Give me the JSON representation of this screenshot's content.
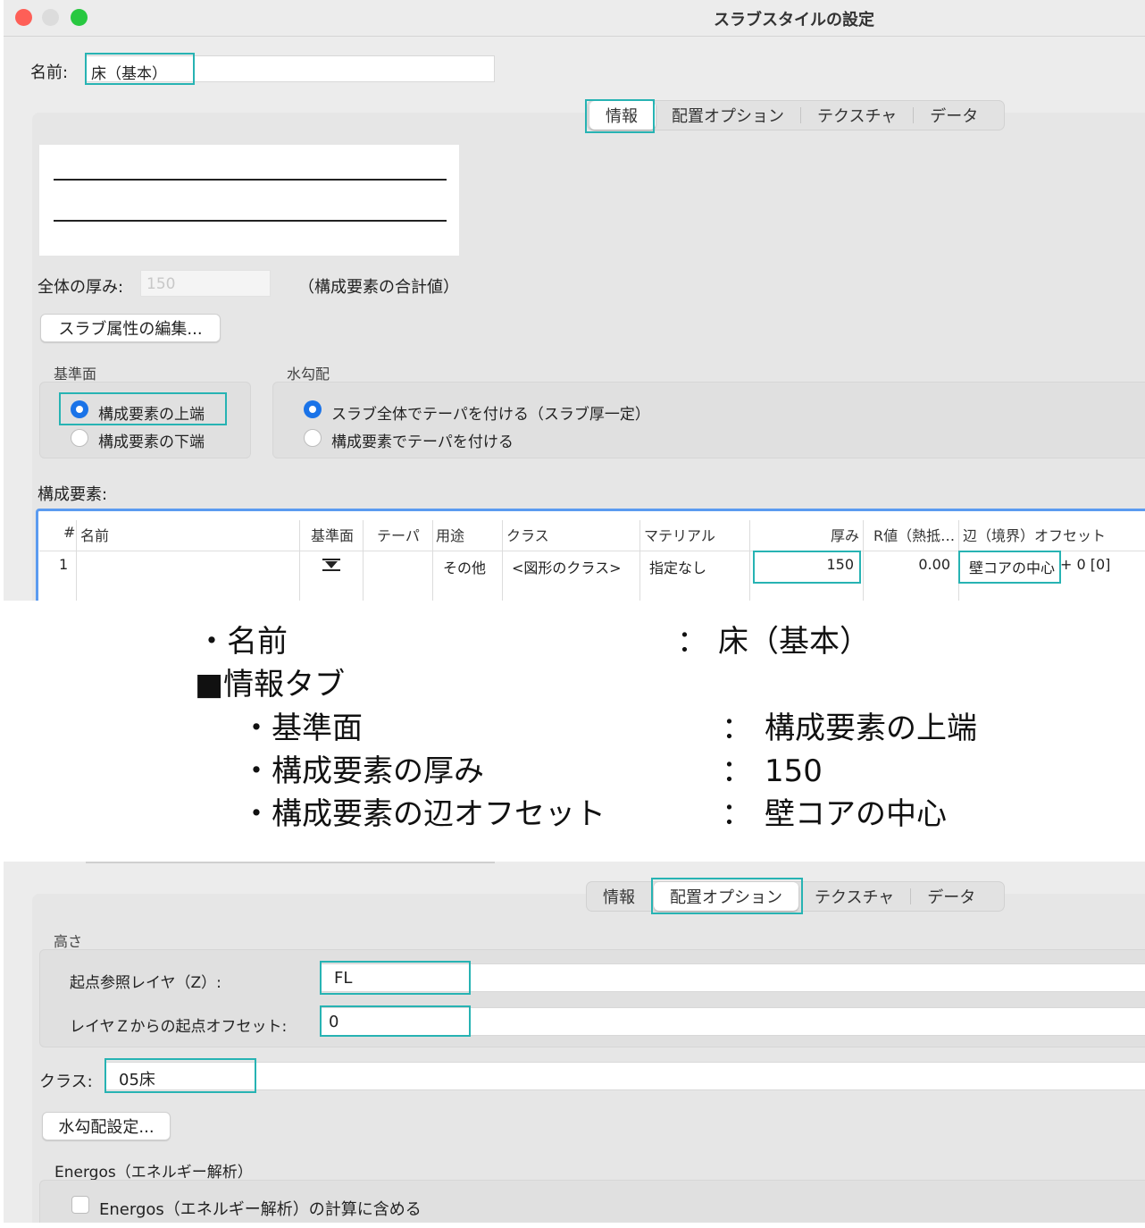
{
  "window": {
    "title": "スラブスタイルの設定",
    "name_label": "名前:",
    "name_value": "床（基本）"
  },
  "tabs": [
    "情報",
    "配置オプション",
    "テクスチャ",
    "データ"
  ],
  "info_tab": {
    "total_thickness_label": "全体の厚み:",
    "total_thickness_value": "150",
    "total_thickness_note": "（構成要素の合計値）",
    "edit_button": "スラブ属性の編集...",
    "datum_label": "基準面",
    "datum_options": [
      "構成要素の上端",
      "構成要素の下端"
    ],
    "drainage_label": "水勾配",
    "drainage_options": [
      "スラブ全体でテーパを付ける（スラブ厚一定）",
      "構成要素でテーパを付ける"
    ],
    "components_label": "構成要素:",
    "table": {
      "headers": [
        "#",
        "名前",
        "基準面",
        "テーパ",
        "用途",
        "クラス",
        "マテリアル",
        "厚み",
        "R値（熱抵…",
        "辺（境界）オフセット"
      ],
      "rows": [
        {
          "num": "1",
          "name": "",
          "taper": "",
          "use": "その他",
          "class": "<図形のクラス>",
          "material": "指定なし",
          "thickness": "150",
          "rvalue": "0.00",
          "offset": "壁コアの中心",
          "offset_extra": "+ 0 [0]"
        }
      ]
    }
  },
  "summary": {
    "name_label": "・名前",
    "name_value": "床（基本）",
    "colon": "：",
    "section": "■情報タブ",
    "items": [
      {
        "label": "・基準面",
        "value": "構成要素の上端"
      },
      {
        "label": "・構成要素の厚み",
        "value": "150"
      },
      {
        "label": "・構成要素の辺オフセット",
        "value": "壁コアの中心"
      }
    ]
  },
  "placement_tab": {
    "height_label": "高さ",
    "ref_layer_label": "起点参照レイヤ（Z）:",
    "ref_layer_value": "FL",
    "offset_label": "レイヤＺからの起点オフセット:",
    "offset_value": "0",
    "class_label": "クラス:",
    "class_value": "05床",
    "drainage_button": "水勾配設定...",
    "energos_label": "Energos（エネルギー解析）",
    "energos_checkbox": "Energos（エネルギー解析）の計算に含める"
  },
  "colors": {
    "highlight": "#27b3b3",
    "radio_selected": "#1a73e8",
    "table_border": "#5b9bf0"
  }
}
